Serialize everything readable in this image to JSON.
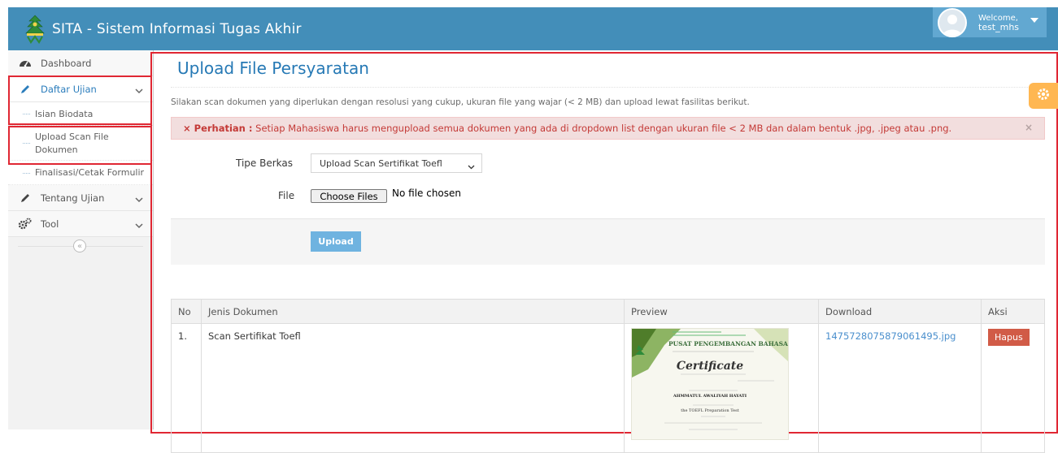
{
  "app": {
    "title": "SITA - Sistem Informasi Tugas Akhir"
  },
  "user": {
    "welcome": "Welcome,",
    "name": "test_mhs"
  },
  "sidebar": {
    "items": [
      {
        "label": "Dashboard"
      },
      {
        "label": "Daftar Ujian"
      },
      {
        "label": "Isian Biodata"
      },
      {
        "label": "Upload Scan File Dokumen"
      },
      {
        "label": "Finalisasi/Cetak Formulir"
      },
      {
        "label": "Tentang Ujian"
      },
      {
        "label": "Tool"
      }
    ],
    "collapse_icon": "«"
  },
  "page": {
    "title": "Upload File Persyaratan",
    "intro": "Silakan scan dokumen yang diperlukan dengan resolusi yang cukup, ukuran file yang wajar (< 2 MB) dan upload lewat fasilitas berikut."
  },
  "alert": {
    "icon": "×",
    "strong": "Perhatian :",
    "text": " Setiap Mahasiswa harus mengupload semua dokumen yang ada di dropdown list dengan ukuran file < 2 MB dan dalam bentuk .jpg, .jpeg atau .png.",
    "close": "×"
  },
  "form": {
    "tipe_label": "Tipe Berkas",
    "tipe_value": "Upload Scan Sertifikat Toefl",
    "file_label": "File",
    "file_button": "Choose Files",
    "file_status": "No file chosen",
    "upload_button": "Upload"
  },
  "table": {
    "headers": [
      "No",
      "Jenis Dokumen",
      "Preview",
      "Download",
      "Aksi"
    ],
    "rows": [
      {
        "no": "1.",
        "jenis": "Scan Sertifikat Toefl",
        "preview": {
          "org": "PUSAT PENGEMBANGAN BAHASA",
          "heading": "Certificate",
          "recipient": "AHMMATUL AWALIYAH HAYATI",
          "test": "the TOEFL Preparation Test"
        },
        "download": "1475728075879061495.jpg",
        "aksi": "Hapus"
      }
    ]
  },
  "colors": {
    "navbar": "#438eb9",
    "accent": "#2679b5",
    "alert_bg": "#f2dede",
    "alert_text": "#c43a37",
    "upload_button": "#6fb3e0",
    "hapus_button": "#d15b47",
    "settings_button": "#ffb752",
    "highlight_box": "#e02733"
  },
  "icons": [
    "logo-icon",
    "dashboard-icon",
    "pencil-icon",
    "cogs-icon",
    "chevron-down-icon",
    "double-chevron-left-icon",
    "gear-icon",
    "user-avatar-icon"
  ]
}
